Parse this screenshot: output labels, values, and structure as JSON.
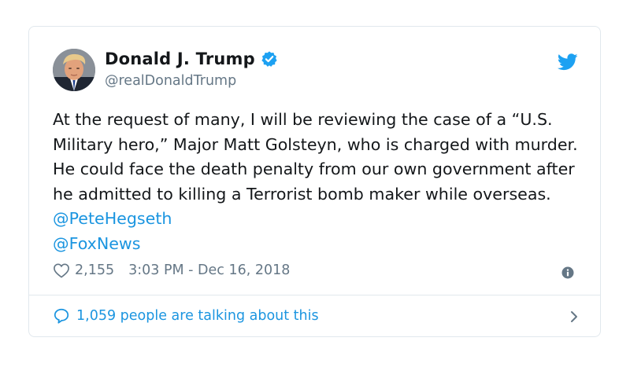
{
  "tweet": {
    "author": {
      "display_name": "Donald J. Trump",
      "handle": "@realDonaldTrump",
      "verified": true,
      "avatar_icon": "portrait-avatar"
    },
    "text_segments": [
      "At the request of many, I will be reviewing the case of a “U.S. Military hero,” Major Matt Golsteyn, who is charged with murder. He could face the death penalty from our own government after he admitted to killing a Terrorist bomb maker while overseas. ",
      "@PeteHegseth",
      "@FoxNews"
    ],
    "likes": "2,155",
    "timestamp": "3:03 PM - Dec 16, 2018",
    "talking_label": "1,059 people are talking about this"
  },
  "icons": {
    "brand": "twitter-bird-icon",
    "verified": "verified-badge-icon",
    "like": "heart-icon",
    "info": "info-icon",
    "reply": "speech-bubble-icon",
    "more": "chevron-right-icon"
  },
  "colors": {
    "brand_blue": "#1da1f2",
    "link_blue": "#1b95e0",
    "secondary_text": "#657786",
    "border": "#e1e8ed"
  }
}
